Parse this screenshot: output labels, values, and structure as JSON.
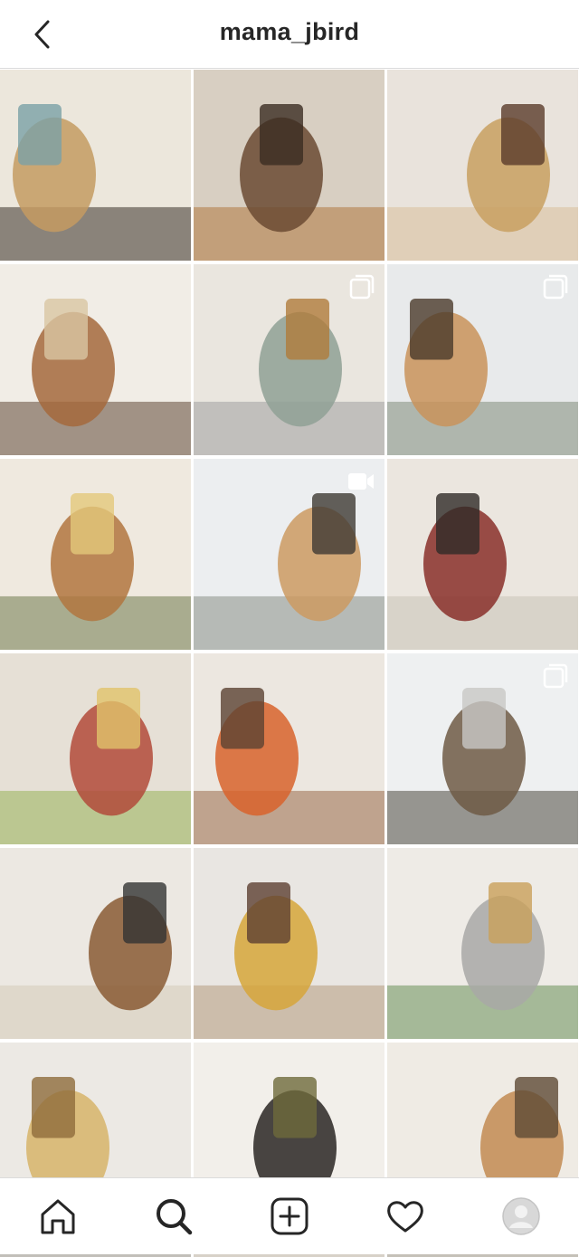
{
  "header": {
    "username": "mama_jbird",
    "back_icon": "chevron-left-icon"
  },
  "grid": {
    "posts": [
      {
        "name": "post-kitchen-wall",
        "colors": [
          "#ece7dc",
          "#c49b62",
          "#7aa1a6",
          "#3a3129"
        ],
        "badge": null
      },
      {
        "name": "post-living-room-stove",
        "colors": [
          "#d8cfc2",
          "#6b4a33",
          "#3b2c22",
          "#b0793f"
        ],
        "badge": null
      },
      {
        "name": "post-mother-daughter-bed",
        "colors": [
          "#e9e3dc",
          "#c8a060",
          "#5a3b2a",
          "#d8c09a"
        ],
        "badge": null
      },
      {
        "name": "post-cozy-living-room",
        "colors": [
          "#f1ede6",
          "#a4683c",
          "#d9c6a3",
          "#5f4734"
        ],
        "badge": null
      },
      {
        "name": "post-archery-map",
        "colors": [
          "#eae6df",
          "#8fa095",
          "#b07c3b",
          "#9e9e9e"
        ],
        "badge": "carousel"
      },
      {
        "name": "post-barrel-sauna",
        "colors": [
          "#e8eaeb",
          "#c9935a",
          "#4a3a2a",
          "#7f8a7a"
        ],
        "badge": "carousel"
      },
      {
        "name": "post-dining-quiche",
        "colors": [
          "#efe9df",
          "#b1763f",
          "#e4c87a",
          "#6f7a4c"
        ],
        "badge": null
      },
      {
        "name": "post-sauna-snow-walk",
        "colors": [
          "#eceef0",
          "#cc9a62",
          "#3f3a33",
          "#8a8f86"
        ],
        "badge": "video"
      },
      {
        "name": "post-kitchen-dog",
        "colors": [
          "#ebe6df",
          "#8a2f2a",
          "#2f2a27",
          "#c9c2b6"
        ],
        "badge": null
      },
      {
        "name": "post-cheese-board",
        "colors": [
          "#e6e0d6",
          "#b24a3a",
          "#e1c36a",
          "#98b35a"
        ],
        "badge": null
      },
      {
        "name": "post-wood-stove-feet",
        "colors": [
          "#ece7e0",
          "#d8632b",
          "#5b4232",
          "#9a6c4b"
        ],
        "badge": null
      },
      {
        "name": "post-snow-camp",
        "colors": [
          "#eef0f1",
          "#6f5a45",
          "#c8c8c5",
          "#4f4a40"
        ],
        "badge": "carousel"
      },
      {
        "name": "post-dining-table",
        "colors": [
          "#ece8e2",
          "#8a5a34",
          "#333333",
          "#d6cbb8"
        ],
        "badge": null
      },
      {
        "name": "post-mother-daughter-hug",
        "colors": [
          "#e9e6e2",
          "#d6a63a",
          "#5d4032",
          "#b59a7e"
        ],
        "badge": null
      },
      {
        "name": "post-reading-couch",
        "colors": [
          "#eeebe6",
          "#a8a8a6",
          "#c9a05a",
          "#6a8f57"
        ],
        "badge": null
      },
      {
        "name": "post-quiche-table",
        "colors": [
          "#ece9e4",
          "#d7b46a",
          "#8f6b3b",
          "#3b3129"
        ],
        "badge": null
      },
      {
        "name": "post-couple-doorway",
        "colors": [
          "#f2efea",
          "#2a2623",
          "#6e6a3b",
          "#b98a5b"
        ],
        "badge": null
      },
      {
        "name": "post-kitchen-interior",
        "colors": [
          "#efebe4",
          "#c28b52",
          "#5e4a35",
          "#3a3330"
        ],
        "badge": null
      },
      {
        "name": "post-partial-1",
        "colors": [
          "#d6d3cf",
          "#4a4742",
          "#8d8a86",
          "#b2aea8"
        ],
        "badge": null
      },
      {
        "name": "post-partial-2",
        "colors": [
          "#e1dcd6",
          "#5b7a4a",
          "#a58458",
          "#cfc8bd"
        ],
        "badge": null
      },
      {
        "name": "post-partial-3",
        "colors": [
          "#d8d4ce",
          "#3a4a35",
          "#6a6a60",
          "#b7b0a5"
        ],
        "badge": null
      }
    ]
  },
  "tabbar": {
    "tabs": [
      {
        "name": "tab-home",
        "icon": "home-icon"
      },
      {
        "name": "tab-search",
        "icon": "search-icon",
        "active": true
      },
      {
        "name": "tab-new-post",
        "icon": "plus-square-icon"
      },
      {
        "name": "tab-activity",
        "icon": "heart-icon"
      },
      {
        "name": "tab-profile",
        "icon": "avatar-icon"
      }
    ]
  },
  "colors": {
    "text": "#262626",
    "divider": "#dbdbdb",
    "background": "#ffffff"
  }
}
